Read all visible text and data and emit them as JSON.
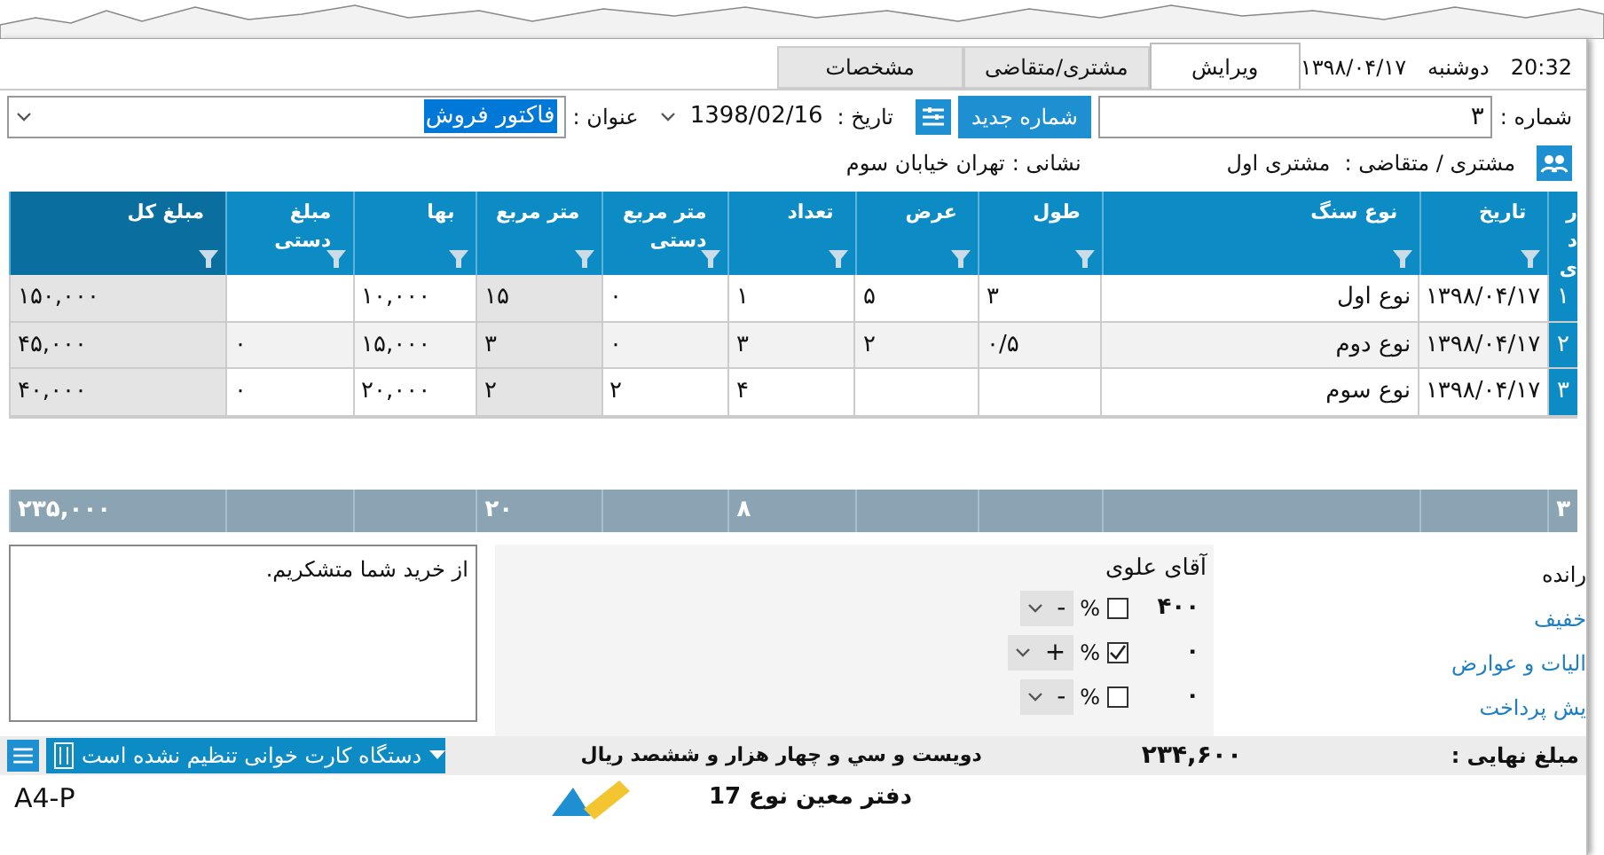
{
  "header": {
    "time": "20:32",
    "weekday": "دوشنبه",
    "date": "۱۳۹۸/۰۴/۱۷"
  },
  "tabs": [
    {
      "label": "ویرایش",
      "selected": true
    },
    {
      "label": "مشتری/متقاضی",
      "selected": false
    },
    {
      "label": "مشخصات",
      "selected": false
    }
  ],
  "form": {
    "number_label": "شماره :",
    "number_value": "۳",
    "new_number_button": "شماره جدید",
    "date_label": "تاریخ :",
    "date_value": "1398/02/16",
    "title_label": "عنوان :",
    "title_value": "فاکتور فروش"
  },
  "customer": {
    "label": "مشتری / متقاضی :",
    "value": "مشتری اول",
    "address_label": "نشانی :",
    "address_value": "تهران خیابان سوم"
  },
  "table": {
    "columns": [
      "ردی",
      "تاریخ",
      "نوع سنگ",
      "طول",
      "عرض",
      "تعداد",
      "متر مربع دستی",
      "متر مربع",
      "بها",
      "مبلغ دستی",
      "مبلغ کل"
    ],
    "rows": [
      [
        "۱",
        "۱۳۹۸/۰۴/۱۷",
        "نوع اول",
        "۳",
        "۵",
        "۱",
        "۰",
        "۱۵",
        "۱۰,۰۰۰",
        null,
        "۱۵۰,۰۰۰"
      ],
      [
        "۲",
        "۱۳۹۸/۰۴/۱۷",
        "نوع دوم",
        "۰/۵",
        "۲",
        "۳",
        "۰",
        "۳",
        "۱۵,۰۰۰",
        "۰",
        "۴۵,۰۰۰"
      ],
      [
        "۳",
        "۱۳۹۸/۰۴/۱۷",
        "نوع سوم",
        null,
        null,
        "۴",
        "۲",
        "۲",
        "۲۰,۰۰۰",
        "۰",
        "۴۰,۰۰۰"
      ]
    ],
    "totals": {
      "row_count": "۳",
      "count": "۸",
      "area": "۲۰",
      "amount": "۲۳۵,۰۰۰"
    }
  },
  "note": "از خرید شما متشکریم.",
  "driver_label": "رانده",
  "driver_value": "آقای علوی",
  "adjustments": [
    {
      "label": "خفیف",
      "value": "۴۰۰",
      "checked": false,
      "percent": "%",
      "sign": "-"
    },
    {
      "label": "الیات و عوارض",
      "value": "۰",
      "checked": true,
      "percent": "%",
      "sign": "+"
    },
    {
      "label": "یش پرداخت",
      "value": "۰",
      "checked": false,
      "percent": "%",
      "sign": "-"
    }
  ],
  "status": {
    "final_label": "مبلغ نهایی :",
    "final_value": "۲۳۴,۶۰۰",
    "words": "دویست و سي و چهار هزار و ششصد ريال",
    "card_reader": "دستگاه کارت خوانی تنظیم نشده است"
  },
  "footer": {
    "title": "دفتر معین نوع 17",
    "page_format": "A4-P"
  }
}
